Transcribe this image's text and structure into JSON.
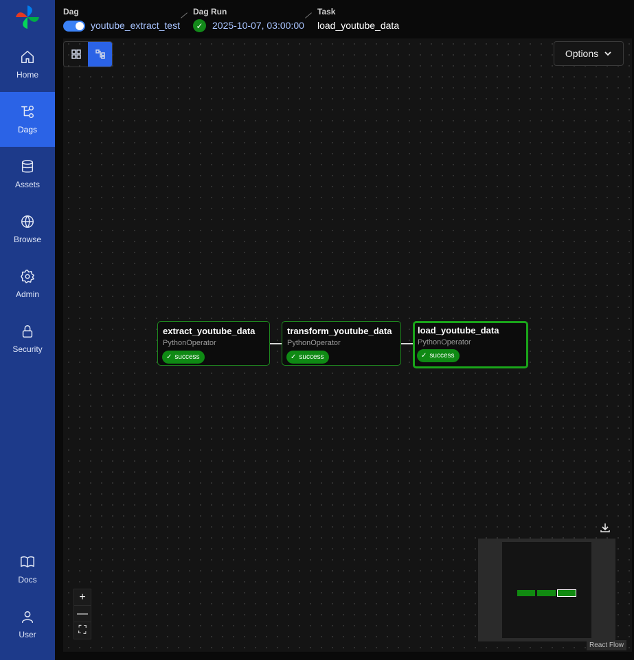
{
  "sidebar": {
    "items": [
      {
        "label": "Home",
        "icon": "home-icon"
      },
      {
        "label": "Dags",
        "icon": "dags-icon",
        "active": true
      },
      {
        "label": "Assets",
        "icon": "database-icon"
      },
      {
        "label": "Browse",
        "icon": "globe-icon"
      },
      {
        "label": "Admin",
        "icon": "gear-icon"
      },
      {
        "label": "Security",
        "icon": "lock-icon"
      }
    ],
    "bottom": [
      {
        "label": "Docs",
        "icon": "book-icon"
      },
      {
        "label": "User",
        "icon": "user-icon"
      }
    ]
  },
  "header": {
    "dag_label": "Dag",
    "dag_value": "youtube_extract_test",
    "dag_run_label": "Dag Run",
    "dag_run_value": "2025-10-07, 03:00:00",
    "task_label": "Task",
    "task_value": "load_youtube_data"
  },
  "toolbar": {
    "options_label": "Options"
  },
  "graph": {
    "nodes": [
      {
        "name": "extract_youtube_data",
        "operator": "PythonOperator",
        "status": "success"
      },
      {
        "name": "transform_youtube_data",
        "operator": "PythonOperator",
        "status": "success"
      },
      {
        "name": "load_youtube_data",
        "operator": "PythonOperator",
        "status": "success",
        "selected": true
      }
    ]
  },
  "zoom": {
    "in": "+",
    "out": "—",
    "fit": "⛶"
  },
  "attribution": "React Flow",
  "colors": {
    "sidebar": "#1d3a8a",
    "active": "#2b63e6",
    "success": "#0f8a14"
  }
}
